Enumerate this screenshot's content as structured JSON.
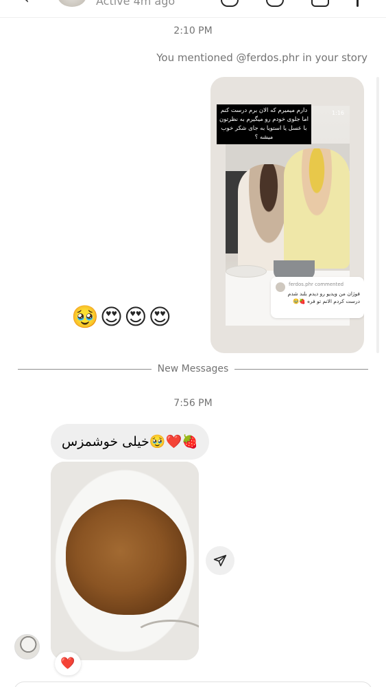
{
  "header": {
    "status": "Active 4m ago",
    "back_glyph": "‹",
    "icons": [
      "audio-call-icon",
      "video-call-icon",
      "flag-icon",
      "info-icon"
    ]
  },
  "thread": {
    "timestamp_1": "2:10 PM",
    "mention_note": "You mentioned @ferdos.phr in your story",
    "story": {
      "caption": "دارم میمیرم که الان برم درست کنم اما جلوی خودم رو میگیرم به نظرتون با عسل یا استویا به جای شکر خوب میشه ؟",
      "duration": "1:16",
      "comment_header": "ferdos.phr commented",
      "comment_text": "فوژان من ویدیو رو دیدم بلند شدم درست کردم الانم تو فره 🍓🥹"
    },
    "reaction_emojis": "🥹😍😍😍",
    "new_messages_label": "New Messages",
    "timestamp_2": "7:56 PM",
    "message_text": "خیلی خوشمزس🥹❤️🍓",
    "photo_reaction": "❤️"
  },
  "colors": {
    "bubble_bg": "#efefef",
    "muted_text": "#737373",
    "heart": "#e0203a"
  }
}
